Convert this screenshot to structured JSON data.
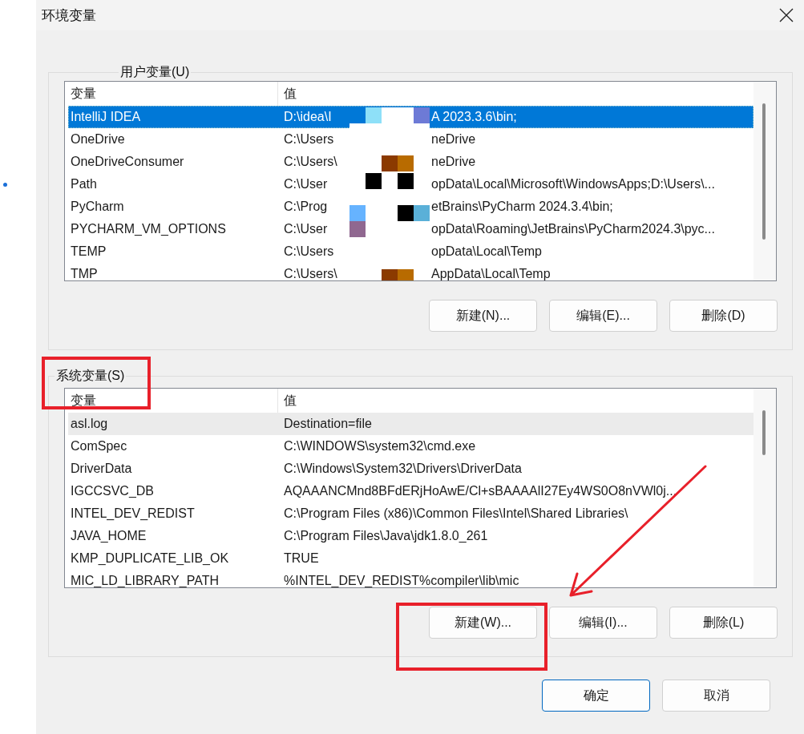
{
  "window": {
    "title": "环境变量"
  },
  "user_variables": {
    "label": "用户变量(U)",
    "columns": [
      "变量",
      "值"
    ],
    "rows": [
      {
        "name": "IntelliJ IDEA",
        "value_parts": [
          "D:\\idea\\I",
          "A 2023.3.6\\bin;"
        ],
        "selected": true
      },
      {
        "name": "OneDrive",
        "value_parts": [
          "C:\\Users",
          "neDrive"
        ],
        "selected": false
      },
      {
        "name": "OneDriveConsumer",
        "value_parts": [
          "C:\\Users\\",
          "neDrive"
        ],
        "selected": false
      },
      {
        "name": "Path",
        "value_parts": [
          "C:\\User",
          "opData\\Local\\Microsoft\\WindowsApps;D:\\Users\\..."
        ],
        "selected": false
      },
      {
        "name": "PyCharm",
        "value_parts": [
          "C:\\Prog",
          "etBrains\\PyCharm 2024.3.4\\bin;"
        ],
        "selected": false
      },
      {
        "name": "PYCHARM_VM_OPTIONS",
        "value_parts": [
          "C:\\User",
          "opData\\Roaming\\JetBrains\\PyCharm2024.3\\pyc..."
        ],
        "selected": false
      },
      {
        "name": "TEMP",
        "value_parts": [
          "C:\\Users",
          "opData\\Local\\Temp"
        ],
        "selected": false
      },
      {
        "name": "TMP",
        "value_parts": [
          "C:\\Users\\",
          "AppData\\Local\\Temp"
        ],
        "selected": false
      }
    ],
    "buttons": [
      "新建(N)...",
      "编辑(E)...",
      "删除(D)"
    ]
  },
  "system_variables": {
    "label": "系统变量(S)",
    "columns": [
      "变量",
      "值"
    ],
    "rows": [
      {
        "name": "asl.log",
        "value": "Destination=file",
        "selected": true
      },
      {
        "name": "ComSpec",
        "value": "C:\\WINDOWS\\system32\\cmd.exe",
        "selected": false
      },
      {
        "name": "DriverData",
        "value": "C:\\Windows\\System32\\Drivers\\DriverData",
        "selected": false
      },
      {
        "name": "IGCCSVC_DB",
        "value": "AQAAANCMnd8BFdERjHoAwE/Cl+sBAAAAlI27Ey4WS0O8nVWl0j...",
        "selected": false
      },
      {
        "name": "INTEL_DEV_REDIST",
        "value": "C:\\Program Files (x86)\\Common Files\\Intel\\Shared Libraries\\",
        "selected": false
      },
      {
        "name": "JAVA_HOME",
        "value": "C:\\Program Files\\Java\\jdk1.8.0_261",
        "selected": false
      },
      {
        "name": "KMP_DUPLICATE_LIB_OK",
        "value": "TRUE",
        "selected": false
      },
      {
        "name": "MIC_LD_LIBRARY_PATH",
        "value": "%INTEL_DEV_REDIST%compiler\\lib\\mic",
        "selected": false
      }
    ],
    "buttons": [
      "新建(W)...",
      "编辑(I)...",
      "删除(L)"
    ]
  },
  "footer_buttons": [
    {
      "label": "确定",
      "default": true
    },
    {
      "label": "取消",
      "default": false
    }
  ]
}
